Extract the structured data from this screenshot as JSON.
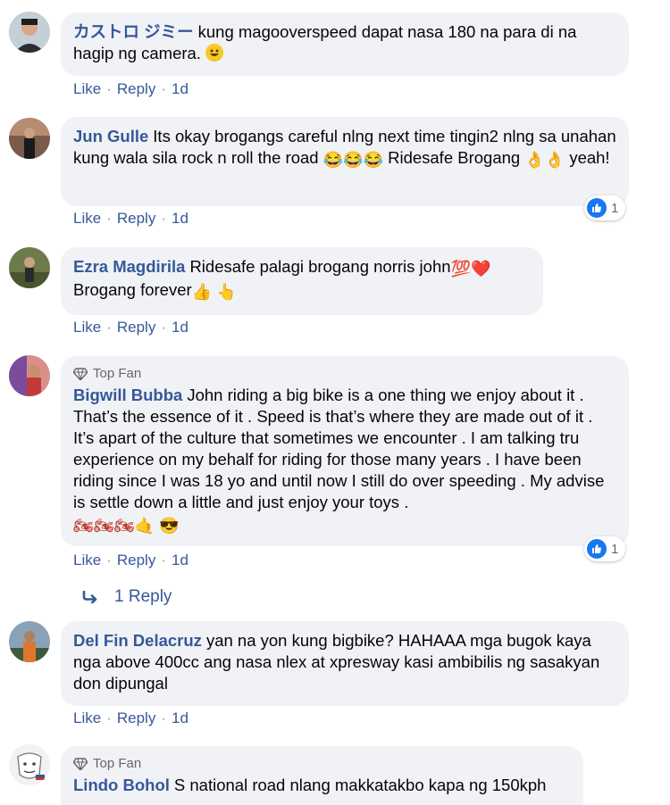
{
  "comments": [
    {
      "author": "カストロ ジミー",
      "text": "kung magooverspeed dapat nasa 180 na para di na hagip ng camera.",
      "emoji_names": [
        "smiley-emoji"
      ],
      "actions": {
        "like": "Like",
        "reply": "Reply",
        "time": "1d"
      }
    },
    {
      "author": "Jun Gulle",
      "text_1": "Its okay brogangs careful nlng next time tingin2 nlng sa unahan kung wala sila rock n roll the road",
      "text_2": "Ridesafe Brogang",
      "text_3": "yeah!",
      "emoji_names": [
        "tears-of-joy-emoji",
        "ok-hand-emoji"
      ],
      "reaction_count": "1",
      "actions": {
        "like": "Like",
        "reply": "Reply",
        "time": "1d"
      }
    },
    {
      "author": "Ezra Magdirila",
      "text_1": "Ridesafe palagi brogang norris john",
      "text_2": "Brogang forever",
      "emoji_names": [
        "hundred-points-emoji",
        "red-heart-emoji",
        "thumbs-up-emoji",
        "pointing-up-emoji"
      ],
      "actions": {
        "like": "Like",
        "reply": "Reply",
        "time": "1d"
      }
    },
    {
      "badge": "Top Fan",
      "author": "Bigwill Bubba",
      "text": "John riding a big bike is a one thing we enjoy about it . That’s the essence of it . Speed is that’s where they are made out of it . It’s apart of the culture that sometimes we encounter . I am talking tru experience on my behalf for riding for those many years . I have been riding since I was 18 yo and until now I still do over speeding . My advise is settle down a little and just enjoy your toys .",
      "emoji_names": [
        "motorcycle-emoji",
        "call-me-hand-emoji",
        "sunglasses-emoji"
      ],
      "reaction_count": "1",
      "actions": {
        "like": "Like",
        "reply": "Reply",
        "time": "1d"
      },
      "replies_link": "1 Reply"
    },
    {
      "author": "Del Fin Delacruz",
      "text": "yan na yon kung bigbike? HAHAAA mga bugok kaya nga above 400cc ang nasa nlex at xpresway kasi ambibilis ng sasakyan don dipungal",
      "actions": {
        "like": "Like",
        "reply": "Reply",
        "time": "1d"
      }
    },
    {
      "badge": "Top Fan",
      "author": "Lindo Bohol",
      "text": "S national road nlang makkatakbo kapa ng 150kph"
    }
  ],
  "colors": {
    "name": "#365899",
    "bubble": "#f0f2f5",
    "like_blue": "#1877f2",
    "meta_gray": "#65676b"
  }
}
